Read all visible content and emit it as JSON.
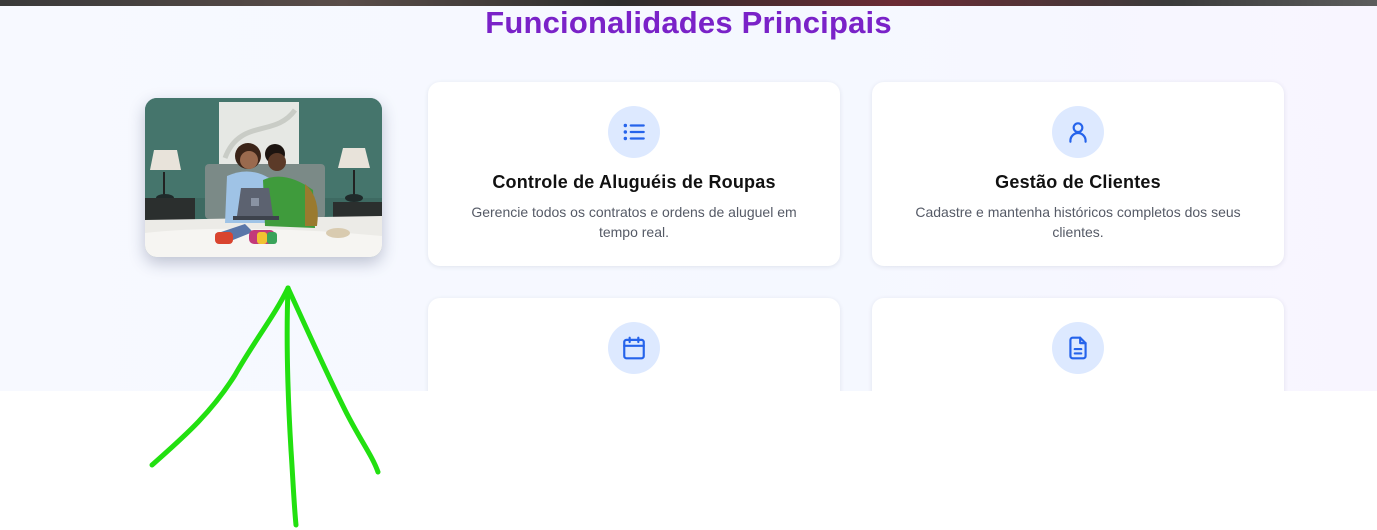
{
  "section": {
    "title": "Funcionalidades Principais"
  },
  "features": [
    {
      "icon": "list-icon",
      "title": "Controle de Aluguéis de Roupas",
      "description": "Gerencie todos os contratos e ordens de aluguel em tempo real."
    },
    {
      "icon": "user-icon",
      "title": "Gestão de Clientes",
      "description": "Cadastre e mantenha históricos completos dos seus clientes."
    },
    {
      "icon": "calendar-icon",
      "title": "",
      "description": ""
    },
    {
      "icon": "document-icon",
      "title": "",
      "description": ""
    }
  ],
  "colors": {
    "title": "#7a22c8",
    "icon": "#2563eb",
    "icon_bg": "#dde9ff",
    "annotation": "#22e010"
  }
}
